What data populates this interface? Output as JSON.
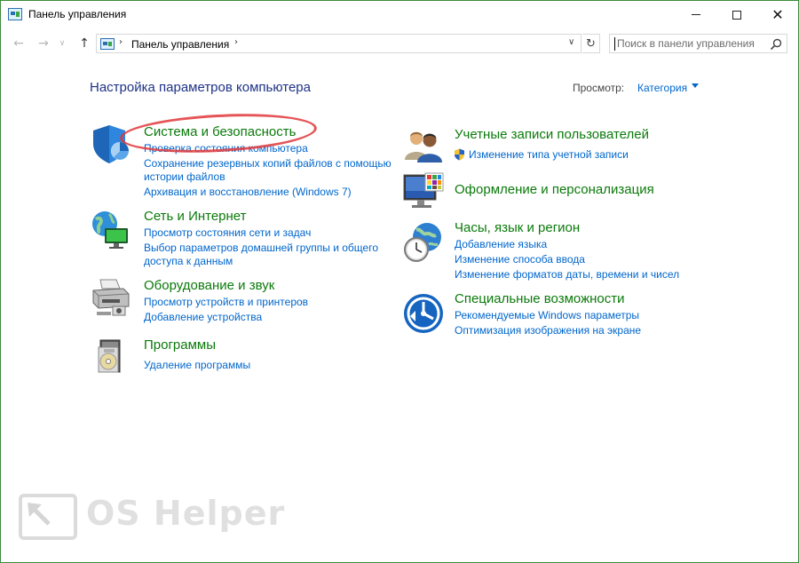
{
  "window": {
    "title": "Панель управления"
  },
  "nav": {
    "breadcrumb": "Панель управления",
    "search_placeholder": "Поиск в панели управления"
  },
  "content": {
    "heading": "Настройка параметров компьютера",
    "view_by_label": "Просмотр:",
    "view_by_value": "Категория"
  },
  "categories_left": [
    {
      "title": "Система и безопасность",
      "icon": "shield-icon",
      "links": [
        "Проверка состояния компьютера",
        "Сохранение резервных копий файлов с помощью",
        "истории файлов",
        "Архивация и восстановление (Windows 7)"
      ]
    },
    {
      "title": "Сеть и Интернет",
      "icon": "network-globe-icon",
      "links": [
        "Просмотр состояния сети и задач",
        "Выбор параметров домашней группы и общего",
        "доступа к данным"
      ]
    },
    {
      "title": "Оборудование и звук",
      "icon": "printer-icon",
      "links": [
        "Просмотр устройств и принтеров",
        "Добавление устройства"
      ]
    },
    {
      "title": "Программы",
      "icon": "programs-disc-icon",
      "links": [
        "Удаление программы"
      ]
    }
  ],
  "categories_right": [
    {
      "title": "Учетные записи пользователей",
      "icon": "users-icon",
      "links": [
        "Изменение типа учетной записи"
      ]
    },
    {
      "title": "Оформление и персонализация",
      "icon": "monitor-palette-icon",
      "links": []
    },
    {
      "title": "Часы, язык и регион",
      "icon": "clock-globe-icon",
      "links": [
        "Добавление языка",
        "Изменение способа ввода",
        "Изменение форматов даты, времени и чисел"
      ]
    },
    {
      "title": "Специальные возможности",
      "icon": "accessibility-icon",
      "links": [
        "Рекомендуемые Windows параметры",
        "Оптимизация изображения на экране"
      ]
    }
  ],
  "watermark": {
    "text": "OS Helper"
  },
  "colors": {
    "title_green": "#0b7a0b",
    "link_blue": "#0066cc",
    "heading_blue": "#1e3287",
    "highlight_red": "#e0373a"
  }
}
